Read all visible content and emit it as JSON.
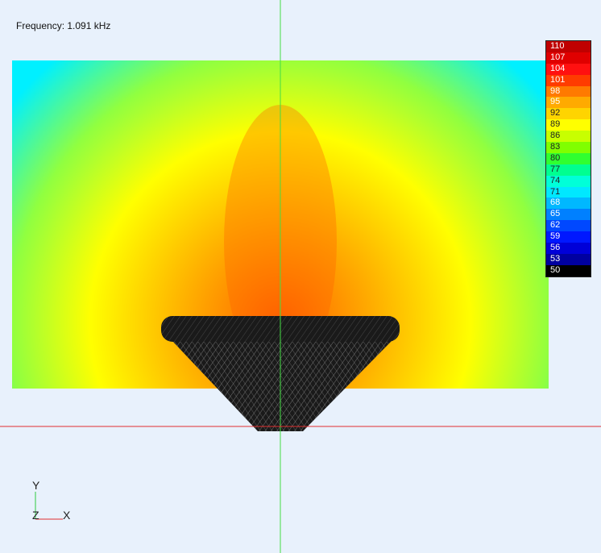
{
  "frequency_label": "Frequency: 1.091 kHz",
  "legend": {
    "values": [
      "110",
      "107",
      "104",
      "101",
      "98",
      "95",
      "92",
      "89",
      "86",
      "83",
      "80",
      "77",
      "74",
      "71",
      "68",
      "65",
      "62",
      "59",
      "56",
      "53",
      "50"
    ],
    "colors": [
      "#c00000",
      "#e00000",
      "#ff1010",
      "#ff3c00",
      "#ff7a00",
      "#ffaa00",
      "#ffd400",
      "#ffff00",
      "#c8ff00",
      "#80ff00",
      "#30ff30",
      "#00ff90",
      "#00ffd8",
      "#00e8ff",
      "#00b8ff",
      "#0080ff",
      "#0048ff",
      "#0018ff",
      "#0000d8",
      "#0000a0",
      "#000000"
    ]
  },
  "axes": {
    "y": "Y",
    "z": "Z",
    "x": "X"
  },
  "guide_colors": {
    "vertical": "#44dd44",
    "horizontal": "#e03030"
  },
  "field_colors": {
    "outer": "#00f0ff",
    "mid": "#90ff40",
    "yellow": "#ffff00",
    "orange": "#ffb000",
    "core": "#ff6000"
  },
  "speaker_color": "#1a1a1a"
}
